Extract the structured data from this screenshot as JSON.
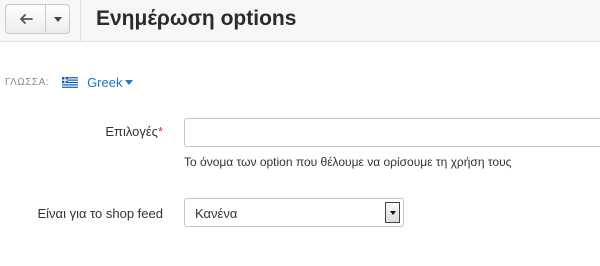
{
  "header": {
    "title": "Ενημέρωση options",
    "back_icon": "arrow-back-icon",
    "menu_icon": "caret-down-icon"
  },
  "language": {
    "label": "ΓΛΩΣΣΑ:",
    "value": "Greek",
    "flag_icon": "greece-flag-icon"
  },
  "form": {
    "options_label": "Επιλογές",
    "options_required_mark": "*",
    "options_value": "",
    "options_help": "Το όνομα των option που θέλουμε να ορίσουμε τη χρήση τους",
    "shop_feed_label": "Είναι για το shop feed",
    "shop_feed_selected": "Κανένα"
  },
  "colors": {
    "accent": "#1f7ac0",
    "required": "#c0392b"
  }
}
